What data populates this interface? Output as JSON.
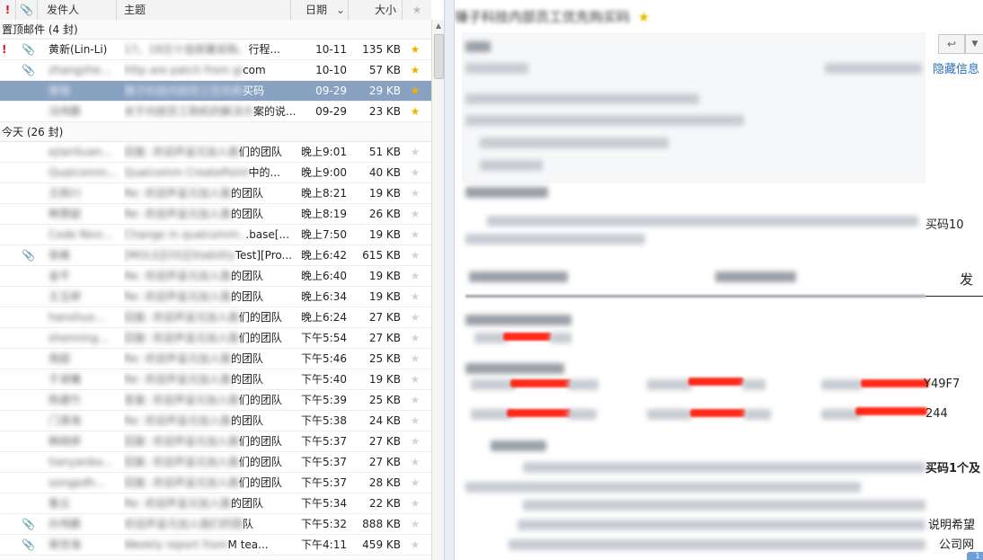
{
  "list": {
    "headers": {
      "flag": "!",
      "attachment": "📎",
      "from": "发件人",
      "subject": "主题",
      "date": "日期",
      "sort": "⌄",
      "size": "大小",
      "star": "★"
    },
    "groups": [
      {
        "label": "置顶邮件 (4 封)"
      },
      {
        "label": "今天 (26 封)"
      }
    ],
    "pinned_rows": [
      {
        "flag": "!",
        "attachment": true,
        "from": "黄新(Lin-Li)",
        "subject_blur": "17。18日十佳部署采购、",
        "subject_visible": "行程...",
        "date": "10-11",
        "size": "135 KB",
        "starred": true,
        "selected": false
      },
      {
        "flag": "",
        "attachment": true,
        "from_blur": "zhangzhe...",
        "subject_blur": "http are patch from gi",
        "subject_visible": "com",
        "date": "10-10",
        "size": "57 KB",
        "starred": true,
        "selected": false
      },
      {
        "flag": "",
        "attachment": false,
        "from_blur": "黄锦",
        "subject_blur": "锤子科技内部员工优先购",
        "subject_visible": "买码",
        "date": "09-29",
        "size": "29 KB",
        "starred": true,
        "selected": true
      },
      {
        "flag": "",
        "attachment": false,
        "from_blur": "冯伟鹏",
        "subject_blur": "关于内部员工购机的解决方",
        "subject_visible": "案的说...",
        "date": "09-29",
        "size": "23 KB",
        "starred": true,
        "selected": false
      }
    ],
    "today_rows": [
      {
        "attachment": false,
        "from_blur": "ejianSuan...",
        "subject_blur": "回复: 欢迎声呈元加入我",
        "subject_visible": "们的团队",
        "date": "晚上9:01",
        "size": "51 KB"
      },
      {
        "attachment": false,
        "from_blur": "Qualcomm...",
        "subject_blur": "Qualcomm CreatePoint",
        "subject_visible": "中的...",
        "date": "晚上9:00",
        "size": "40 KB"
      },
      {
        "attachment": false,
        "from_blur": "王刚川",
        "subject_blur": "Re: 欢迎声呈元加入我",
        "subject_visible": "的团队",
        "date": "晚上8:21",
        "size": "19 KB"
      },
      {
        "attachment": false,
        "from_blur": "韩慧超",
        "subject_blur": "Re: 欢迎声呈元加入我",
        "subject_visible": "的团队",
        "date": "晚上8:19",
        "size": "26 KB"
      },
      {
        "attachment": false,
        "from_blur": "Code Revi...",
        "subject_blur": "Change in qualcomm..",
        "subject_visible": ".base[...",
        "date": "晚上7:50",
        "size": "19 KB"
      },
      {
        "attachment": true,
        "from_blur": "张峰",
        "subject_blur": "[MOLS][OS][Stability",
        "subject_visible": "Test][Pro...",
        "date": "晚上6:42",
        "size": "615 KB"
      },
      {
        "attachment": false,
        "from_blur": "金平",
        "subject_blur": "Re: 欢迎声呈元加入我",
        "subject_visible": "的团队",
        "date": "晚上6:40",
        "size": "19 KB"
      },
      {
        "attachment": false,
        "from_blur": "王玉婷",
        "subject_blur": "Re: 欢迎声呈元加入我",
        "subject_visible": "的团队",
        "date": "晚上6:34",
        "size": "19 KB"
      },
      {
        "attachment": false,
        "from_blur": "hanshuo...",
        "subject_blur": "回复: 欢迎声呈元加入我",
        "subject_visible": "们的团队",
        "date": "晚上6:24",
        "size": "27 KB"
      },
      {
        "attachment": false,
        "from_blur": "shenning...",
        "subject_blur": "回复: 欢迎声呈元加入我",
        "subject_visible": "们的团队",
        "date": "下午5:54",
        "size": "27 KB"
      },
      {
        "attachment": false,
        "from_blur": "周超",
        "subject_blur": "Re: 欢迎声呈元加入我",
        "subject_visible": "的团队",
        "date": "下午5:46",
        "size": "25 KB"
      },
      {
        "attachment": false,
        "from_blur": "于淑曦",
        "subject_blur": "Re: 欢迎声呈元加入我",
        "subject_visible": "的团队",
        "date": "下午5:40",
        "size": "19 KB"
      },
      {
        "attachment": false,
        "from_blur": "陈建竹",
        "subject_blur": "答复: 欢迎声呈元加入我",
        "subject_visible": "们的团队",
        "date": "下午5:39",
        "size": "25 KB"
      },
      {
        "attachment": false,
        "from_blur": "门清海",
        "subject_blur": "Re: 欢迎声呈元加入我",
        "subject_visible": "的团队",
        "date": "下午5:38",
        "size": "24 KB"
      },
      {
        "attachment": false,
        "from_blur": "韩晓婷",
        "subject_blur": "回复: 欢迎声呈元加入我",
        "subject_visible": "们的团队",
        "date": "下午5:37",
        "size": "27 KB"
      },
      {
        "attachment": false,
        "from_blur": "tianyanbo...",
        "subject_blur": "回复: 欢迎声呈元加入我",
        "subject_visible": "们的团队",
        "date": "下午5:37",
        "size": "27 KB"
      },
      {
        "attachment": false,
        "from_blur": "songpdh...",
        "subject_blur": "回复: 欢迎声呈元加入我",
        "subject_visible": "们的团队",
        "date": "下午5:37",
        "size": "28 KB"
      },
      {
        "attachment": false,
        "from_blur": "鲁云",
        "subject_blur": "Re: 欢迎声呈元加入我",
        "subject_visible": "的团队",
        "date": "下午5:34",
        "size": "22 KB"
      },
      {
        "attachment": true,
        "from_blur": "孙伟鹏",
        "subject_blur": "欢迎声呈元加入我们的团",
        "subject_visible": "队",
        "date": "下午5:32",
        "size": "888 KB"
      },
      {
        "attachment": true,
        "from_blur": "蒋世海",
        "subject_blur": "Weekly report from",
        "subject_visible": "M tea...",
        "date": "下午4:11",
        "size": "459 KB"
      }
    ]
  },
  "reader": {
    "title_blur": "锤子科技内部员工优先购买码",
    "title_star": "★",
    "reply_icon": "↩",
    "more_icon": "▼",
    "hide_info": "隐藏信息",
    "body_fragments": {
      "f1": "买码10",
      "f2": "发",
      "f3": "Y49F7",
      "f4": "244",
      "f5": "买码1个及",
      "f6": "说明希望",
      "f7": "公司网"
    },
    "badge": "1"
  },
  "colors": {
    "selected_row": "#8aa2c1",
    "star": "#f0b400",
    "flag": "#dd1111",
    "link": "#2a6fbf",
    "redaction": "#ff2a1a"
  }
}
